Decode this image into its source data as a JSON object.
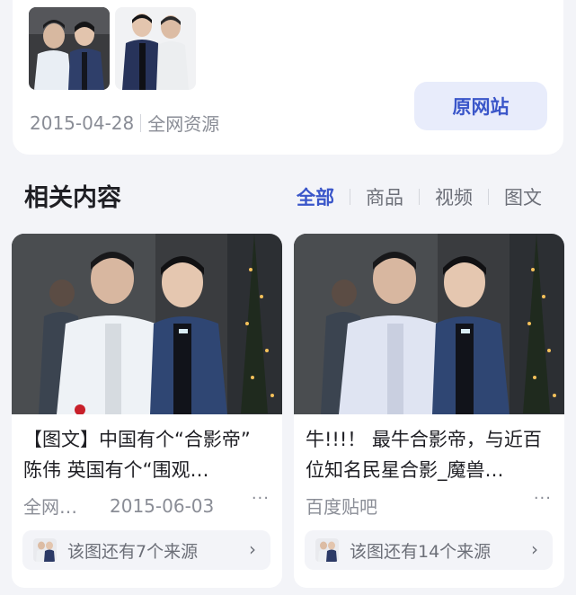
{
  "top_card": {
    "date": "2015-04-28",
    "source": "全网资源",
    "source_button": "原网站"
  },
  "related": {
    "title": "相关内容",
    "tabs": [
      {
        "label": "全部",
        "active": true
      },
      {
        "label": "商品",
        "active": false
      },
      {
        "label": "视频",
        "active": false
      },
      {
        "label": "图文",
        "active": false
      }
    ]
  },
  "results": [
    {
      "title": "【图文】中国有个“合影帝” 陈伟 英国有个“围观…",
      "site": "全网…",
      "date": "2015-06-03",
      "more": "···",
      "sources_text": "该图还有7个来源",
      "icons": {
        "chevron": "chevron-right-icon"
      }
    },
    {
      "title": "牛!!!！ 最牛合影帝，与近百位知名民星合影_魔兽…",
      "site": "百度贴吧",
      "date": "",
      "more": "···",
      "sources_text": "该图还有14个来源",
      "icons": {
        "chevron": "chevron-right-icon"
      }
    }
  ],
  "colors": {
    "accent": "#3a56c9",
    "button_bg": "#e8ecfb",
    "page_bg": "#f3f4f8",
    "muted_text": "#8a8d96"
  }
}
